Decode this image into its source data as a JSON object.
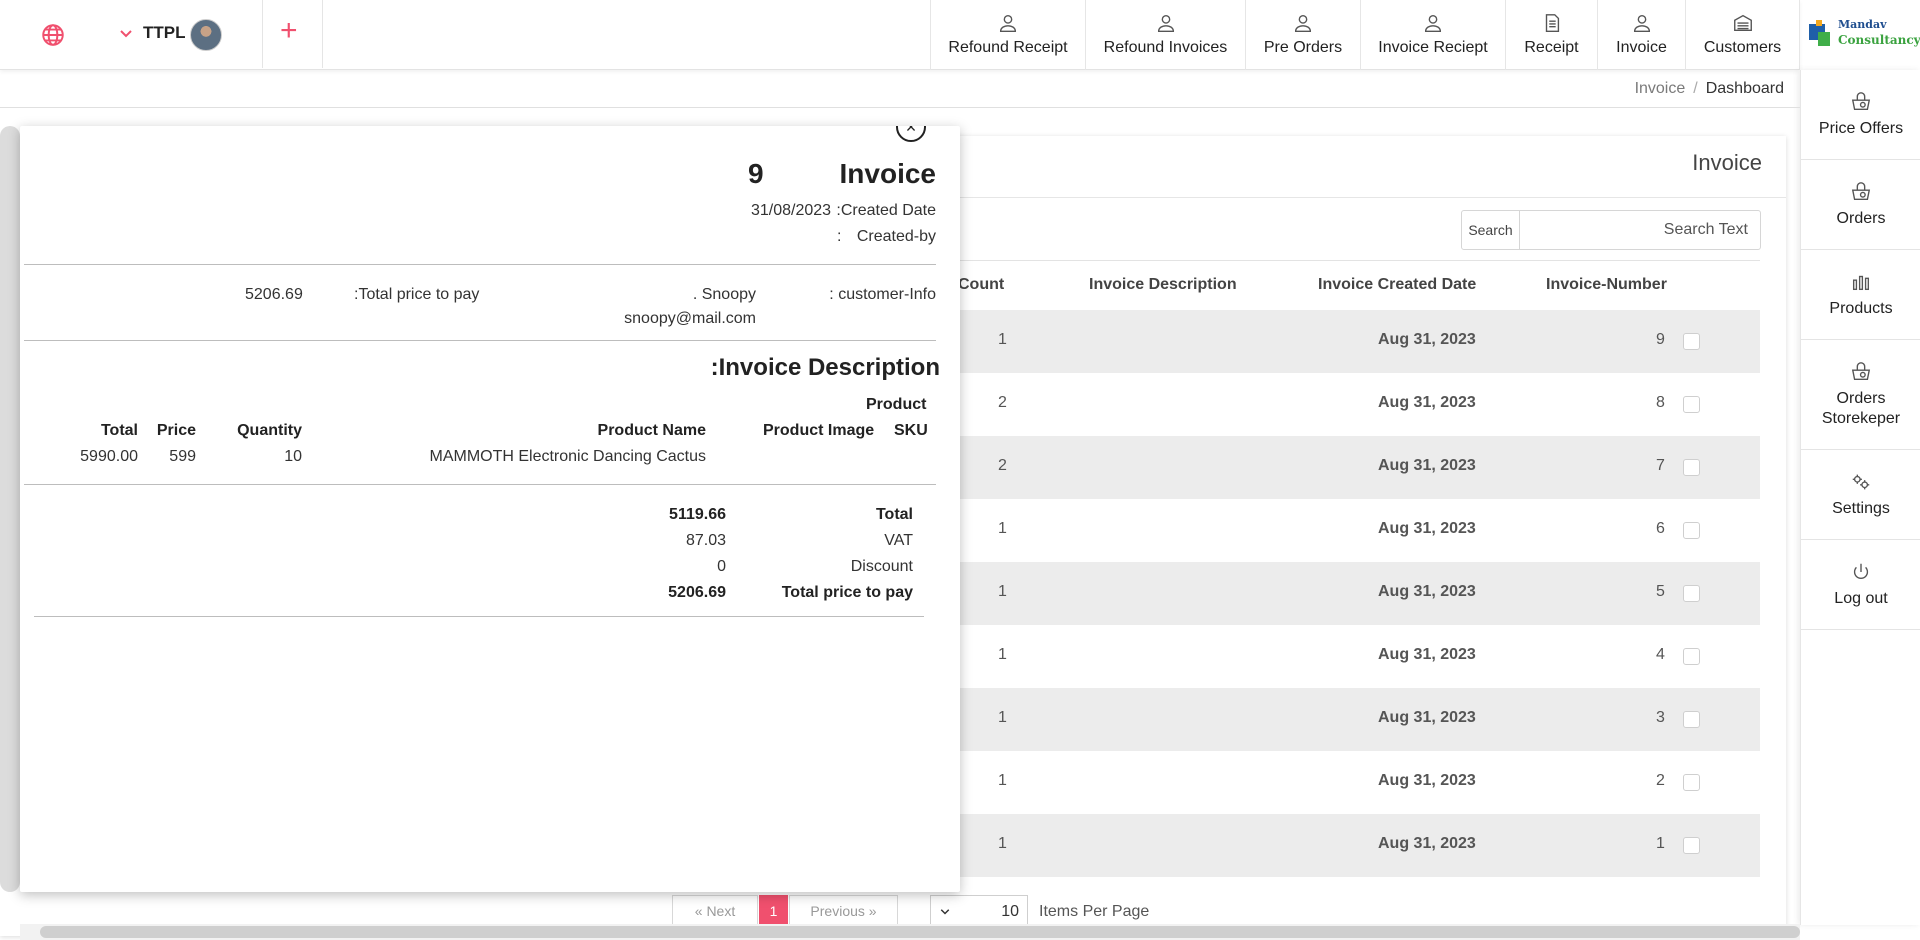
{
  "topbar": {
    "org_name": "TTPL",
    "nav": [
      {
        "label": "Refound Receipt",
        "icon": "user-icon"
      },
      {
        "label": "Refound Invoices",
        "icon": "user-icon"
      },
      {
        "label": "Pre Orders",
        "icon": "user-icon"
      },
      {
        "label": "Invoice Reciept",
        "icon": "user-icon"
      },
      {
        "label": "Receipt",
        "icon": "document-icon"
      },
      {
        "label": "Invoice",
        "icon": "user-icon"
      },
      {
        "label": "Customers",
        "icon": "cabinet-icon"
      }
    ],
    "logo": {
      "line1": "Mandav",
      "line2": "Consultancy"
    }
  },
  "sidebar": {
    "items": [
      {
        "label": "Price Offers",
        "icon": "basket-icon"
      },
      {
        "label": "Orders",
        "icon": "basket-icon"
      },
      {
        "label": "Products",
        "icon": "bar-chart-icon"
      },
      {
        "label": "Orders Storekeper",
        "icon": "basket-icon"
      },
      {
        "label": "Settings",
        "icon": "gears-icon"
      },
      {
        "label": "Log out",
        "icon": "power-icon"
      }
    ]
  },
  "breadcrumb": {
    "parent": "Invoice",
    "separator": "/",
    "current": "Dashboard"
  },
  "card": {
    "title": "Invoice",
    "search": {
      "button_label": "Search",
      "placeholder": "Search Text"
    },
    "columns": {
      "count": "Count",
      "description": "Invoice Description",
      "created": "Invoice Created Date",
      "number": "Invoice-Number"
    },
    "rows": [
      {
        "count": "1",
        "description": "",
        "created": "Aug 31, 2023",
        "number": "9"
      },
      {
        "count": "2",
        "description": "",
        "created": "Aug 31, 2023",
        "number": "8"
      },
      {
        "count": "2",
        "description": "",
        "created": "Aug 31, 2023",
        "number": "7"
      },
      {
        "count": "1",
        "description": "",
        "created": "Aug 31, 2023",
        "number": "6"
      },
      {
        "count": "1",
        "description": "",
        "created": "Aug 31, 2023",
        "number": "5"
      },
      {
        "count": "1",
        "description": "",
        "created": "Aug 31, 2023",
        "number": "4"
      },
      {
        "count": "1",
        "description": "",
        "created": "Aug 31, 2023",
        "number": "3"
      },
      {
        "count": "1",
        "description": "",
        "created": "Aug 31, 2023",
        "number": "2"
      },
      {
        "count": "1",
        "description": "",
        "created": "Aug 31, 2023",
        "number": "1"
      }
    ],
    "pagination": {
      "next": "« Next",
      "current_page": "1",
      "previous": "Previous »"
    },
    "items_per_page": {
      "value": "10",
      "label": "Items Per Page"
    }
  },
  "modal": {
    "title": "Invoice",
    "number": "9",
    "created_date_value": "31/08/2023",
    "created_date_label": ":Created Date",
    "created_by_sep": ":",
    "created_by_label": "Created-by",
    "customer_label": ": customer-Info",
    "customer_name": ". Snoopy",
    "customer_email": "snoopy@mail.com",
    "total_pay_label": ":Total price to pay",
    "total_pay_value": "5206.69",
    "description_heading": ":Invoice Description",
    "product_columns": {
      "sku": "SKU",
      "sku_top": "Product",
      "image": "Product Image",
      "name": "Product Name",
      "quantity": "Quantity",
      "price": "Price",
      "total": "Total"
    },
    "products": [
      {
        "name": "MAMMOTH Electronic Dancing Cactus",
        "quantity": "10",
        "price": "599",
        "total": "5990.00"
      }
    ],
    "summary": {
      "total_label": "Total",
      "total_value": "5119.66",
      "vat_label": "VAT",
      "vat_value": "87.03",
      "discount_label": "Discount",
      "discount_value": "0",
      "pay_label": "Total price to pay",
      "pay_value": "5206.69"
    }
  },
  "colors": {
    "accent": "#f0506e",
    "row_stripe": "#ececec"
  }
}
